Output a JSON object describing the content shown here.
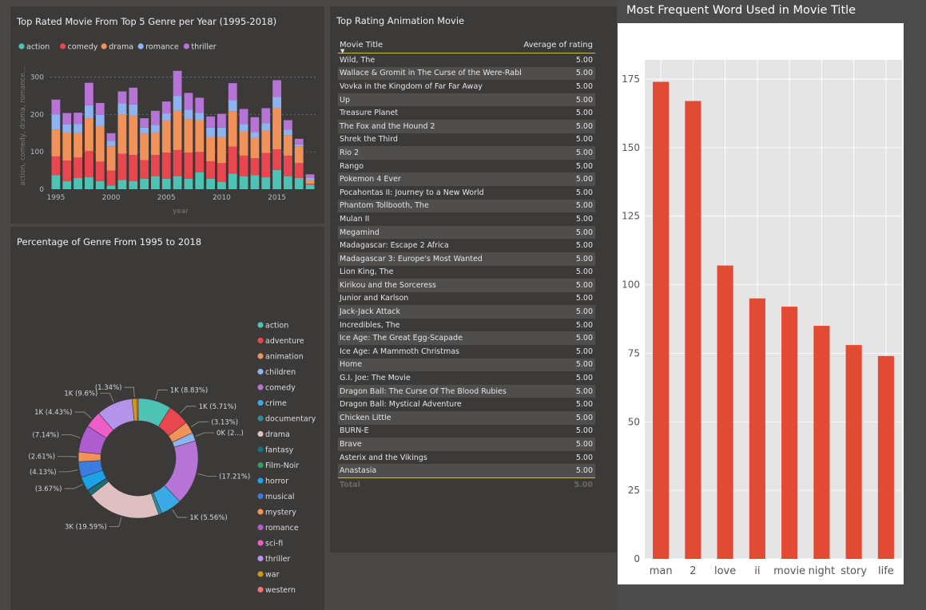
{
  "stacked": {
    "title": "Top Rated Movie From Top 5 Genre per Year (1995-2018)",
    "xlabel": "year",
    "ylabel": "action, comedy, drama, romance...",
    "legend": [
      {
        "name": "action",
        "color": "#4ec3b3"
      },
      {
        "name": "comedy",
        "color": "#e9474f"
      },
      {
        "name": "drama",
        "color": "#f2925b"
      },
      {
        "name": "romance",
        "color": "#8fb3ee"
      },
      {
        "name": "thriller",
        "color": "#b574d6"
      }
    ],
    "y_ticks": [
      "0",
      "100",
      "200",
      "300"
    ],
    "x_ticks": [
      "1995",
      "2000",
      "2005",
      "2010",
      "2015"
    ]
  },
  "donut": {
    "title": "Percentage of Genre From 1995 to 2018",
    "labels": [
      {
        "key": "action",
        "text": "1K (8.83%)"
      },
      {
        "key": "adventure",
        "text": "1K (5.71%)"
      },
      {
        "key": "animation",
        "text": "(3.13%)"
      },
      {
        "key": "children",
        "text": "0K (2...)"
      },
      {
        "key": "comedy",
        "text": "(17.21%)"
      },
      {
        "key": "crime",
        "text": "1K (5.56%)"
      },
      {
        "key": "drama",
        "text": "3K (19.59%)"
      },
      {
        "key": "horror",
        "text": "(3.67%)"
      },
      {
        "key": "musical",
        "text": "(4.13%)"
      },
      {
        "key": "mystery",
        "text": "(2.61%)"
      },
      {
        "key": "romance",
        "text": "(7.14%)"
      },
      {
        "key": "sci-fi",
        "text": "1K (4.43%)"
      },
      {
        "key": "thriller",
        "text": "1K (9.6%)"
      },
      {
        "key": "war",
        "text": "(1.34%)"
      }
    ],
    "legend": [
      {
        "name": "action",
        "color": "#4ec3b3"
      },
      {
        "name": "adventure",
        "color": "#e9474f"
      },
      {
        "name": "animation",
        "color": "#f2925b"
      },
      {
        "name": "children",
        "color": "#8fb3ee"
      },
      {
        "name": "comedy",
        "color": "#b574d6"
      },
      {
        "name": "crime",
        "color": "#3ba9e8"
      },
      {
        "name": "documentary",
        "color": "#2d8f98"
      },
      {
        "name": "drama",
        "color": "#dfbfc2"
      },
      {
        "name": "fantasy",
        "color": "#1b6f7a"
      },
      {
        "name": "Film-Noir",
        "color": "#2fa05c"
      },
      {
        "name": "horror",
        "color": "#1aa3e8"
      },
      {
        "name": "musical",
        "color": "#3c7be0"
      },
      {
        "name": "mystery",
        "color": "#f2925b"
      },
      {
        "name": "romance",
        "color": "#b05cd1"
      },
      {
        "name": "sci-fi",
        "color": "#ee5ec8"
      },
      {
        "name": "thriller",
        "color": "#b394ea"
      },
      {
        "name": "war",
        "color": "#c89b1a"
      },
      {
        "name": "western",
        "color": "#f27373"
      }
    ]
  },
  "table": {
    "title": "Top Rating Animation Movie",
    "col1": "Movie Title",
    "col2": "Average of rating",
    "rows": [
      {
        "title": "Wild, The",
        "rating": "5.00"
      },
      {
        "title": "Wallace & Gromit in The Curse of the Were-Rabbit",
        "rating": "5.00"
      },
      {
        "title": "Vovka in the Kingdom of Far Far Away",
        "rating": "5.00"
      },
      {
        "title": "Up",
        "rating": "5.00"
      },
      {
        "title": "Treasure Planet",
        "rating": "5.00"
      },
      {
        "title": "The Fox and the Hound 2",
        "rating": "5.00"
      },
      {
        "title": "Shrek the Third",
        "rating": "5.00"
      },
      {
        "title": "Rio 2",
        "rating": "5.00"
      },
      {
        "title": "Rango",
        "rating": "5.00"
      },
      {
        "title": "Pokemon 4 Ever",
        "rating": "5.00"
      },
      {
        "title": "Pocahontas II: Journey to a New World",
        "rating": "5.00"
      },
      {
        "title": "Phantom Tollbooth, The",
        "rating": "5.00"
      },
      {
        "title": "Mulan II",
        "rating": "5.00"
      },
      {
        "title": "Megamind",
        "rating": "5.00"
      },
      {
        "title": "Madagascar: Escape 2 Africa",
        "rating": "5.00"
      },
      {
        "title": "Madagascar 3: Europe's Most Wanted",
        "rating": "5.00"
      },
      {
        "title": "Lion King, The",
        "rating": "5.00"
      },
      {
        "title": "Kirikou and the Sorceress",
        "rating": "5.00"
      },
      {
        "title": "Junior and Karlson",
        "rating": "5.00"
      },
      {
        "title": "Jack-Jack Attack",
        "rating": "5.00"
      },
      {
        "title": "Incredibles, The",
        "rating": "5.00"
      },
      {
        "title": "Ice Age: The Great Egg-Scapade",
        "rating": "5.00"
      },
      {
        "title": "Ice Age: A Mammoth Christmas",
        "rating": "5.00"
      },
      {
        "title": "Home",
        "rating": "5.00"
      },
      {
        "title": "G.I. Joe: The Movie",
        "rating": "5.00"
      },
      {
        "title": "Dragon Ball: The Curse Of The Blood Rubies",
        "rating": "5.00"
      },
      {
        "title": "Dragon Ball: Mystical Adventure",
        "rating": "5.00"
      },
      {
        "title": "Chicken Little",
        "rating": "5.00"
      },
      {
        "title": "BURN-E",
        "rating": "5.00"
      },
      {
        "title": "Brave",
        "rating": "5.00"
      },
      {
        "title": "Asterix and the Vikings",
        "rating": "5.00"
      },
      {
        "title": "Anastasia",
        "rating": "5.00"
      }
    ],
    "total_label": "Total",
    "total_value": "5.00"
  },
  "words": {
    "title": "Most Frequent Word Used in Movie Title",
    "color": "#e24a33"
  },
  "chart_data": [
    {
      "type": "bar",
      "title": "Top Rated Movie From Top 5 Genre per Year (1995-2018)",
      "xlabel": "year",
      "ylabel": "action, comedy, drama, romance...",
      "stacked": true,
      "categories": [
        1995,
        1996,
        1997,
        1998,
        1999,
        2000,
        2001,
        2002,
        2003,
        2004,
        2005,
        2006,
        2007,
        2008,
        2009,
        2010,
        2011,
        2012,
        2013,
        2014,
        2015,
        2016,
        2017,
        2018
      ],
      "series": [
        {
          "name": "action",
          "values": [
            38,
            22,
            30,
            32,
            22,
            10,
            25,
            22,
            28,
            35,
            28,
            35,
            28,
            45,
            28,
            20,
            42,
            35,
            38,
            32,
            52,
            35,
            30,
            12
          ]
        },
        {
          "name": "comedy",
          "values": [
            50,
            55,
            55,
            70,
            52,
            40,
            70,
            70,
            50,
            57,
            70,
            70,
            70,
            55,
            47,
            50,
            72,
            55,
            45,
            65,
            55,
            55,
            40,
            3
          ]
        },
        {
          "name": "drama",
          "values": [
            72,
            75,
            65,
            88,
            95,
            65,
            105,
            105,
            70,
            60,
            85,
            105,
            90,
            85,
            65,
            70,
            95,
            65,
            55,
            60,
            110,
            55,
            45,
            10
          ]
        },
        {
          "name": "romance",
          "values": [
            40,
            22,
            25,
            35,
            30,
            15,
            30,
            30,
            17,
            20,
            20,
            40,
            25,
            20,
            25,
            25,
            30,
            20,
            15,
            20,
            30,
            15,
            5,
            5
          ]
        },
        {
          "name": "thriller",
          "values": [
            40,
            30,
            30,
            60,
            32,
            20,
            32,
            45,
            25,
            38,
            32,
            67,
            45,
            40,
            30,
            37,
            45,
            40,
            40,
            40,
            45,
            25,
            15,
            10
          ]
        }
      ],
      "ylim": [
        0,
        340
      ],
      "grid": true,
      "legend_position": "top-left"
    },
    {
      "type": "pie",
      "title": "Percentage of Genre From 1995 to 2018",
      "donut": true,
      "categories": [
        "action",
        "adventure",
        "animation",
        "children",
        "comedy",
        "crime",
        "documentary",
        "drama",
        "fantasy",
        "Film-Noir",
        "horror",
        "musical",
        "mystery",
        "romance",
        "sci-fi",
        "thriller",
        "war",
        "western"
      ],
      "values": [
        8.83,
        5.71,
        3.13,
        2.2,
        17.21,
        5.56,
        0.9,
        19.59,
        1.5,
        0.2,
        3.67,
        4.13,
        2.61,
        7.14,
        4.43,
        9.6,
        1.34,
        0.3
      ],
      "legend_position": "right"
    },
    {
      "type": "table",
      "title": "Top Rating Animation Movie",
      "columns": [
        "Movie Title",
        "Average of rating"
      ]
    },
    {
      "type": "bar",
      "title": "Most Frequent Word Used in Movie Title",
      "categories": [
        "man",
        "2",
        "love",
        "ii",
        "movie",
        "night",
        "story",
        "life"
      ],
      "values": [
        174,
        167,
        107,
        95,
        92,
        85,
        78,
        74
      ],
      "ylim": [
        0,
        180
      ],
      "y_ticks": [
        0,
        25,
        50,
        75,
        100,
        125,
        150,
        175
      ],
      "grid": true
    }
  ]
}
